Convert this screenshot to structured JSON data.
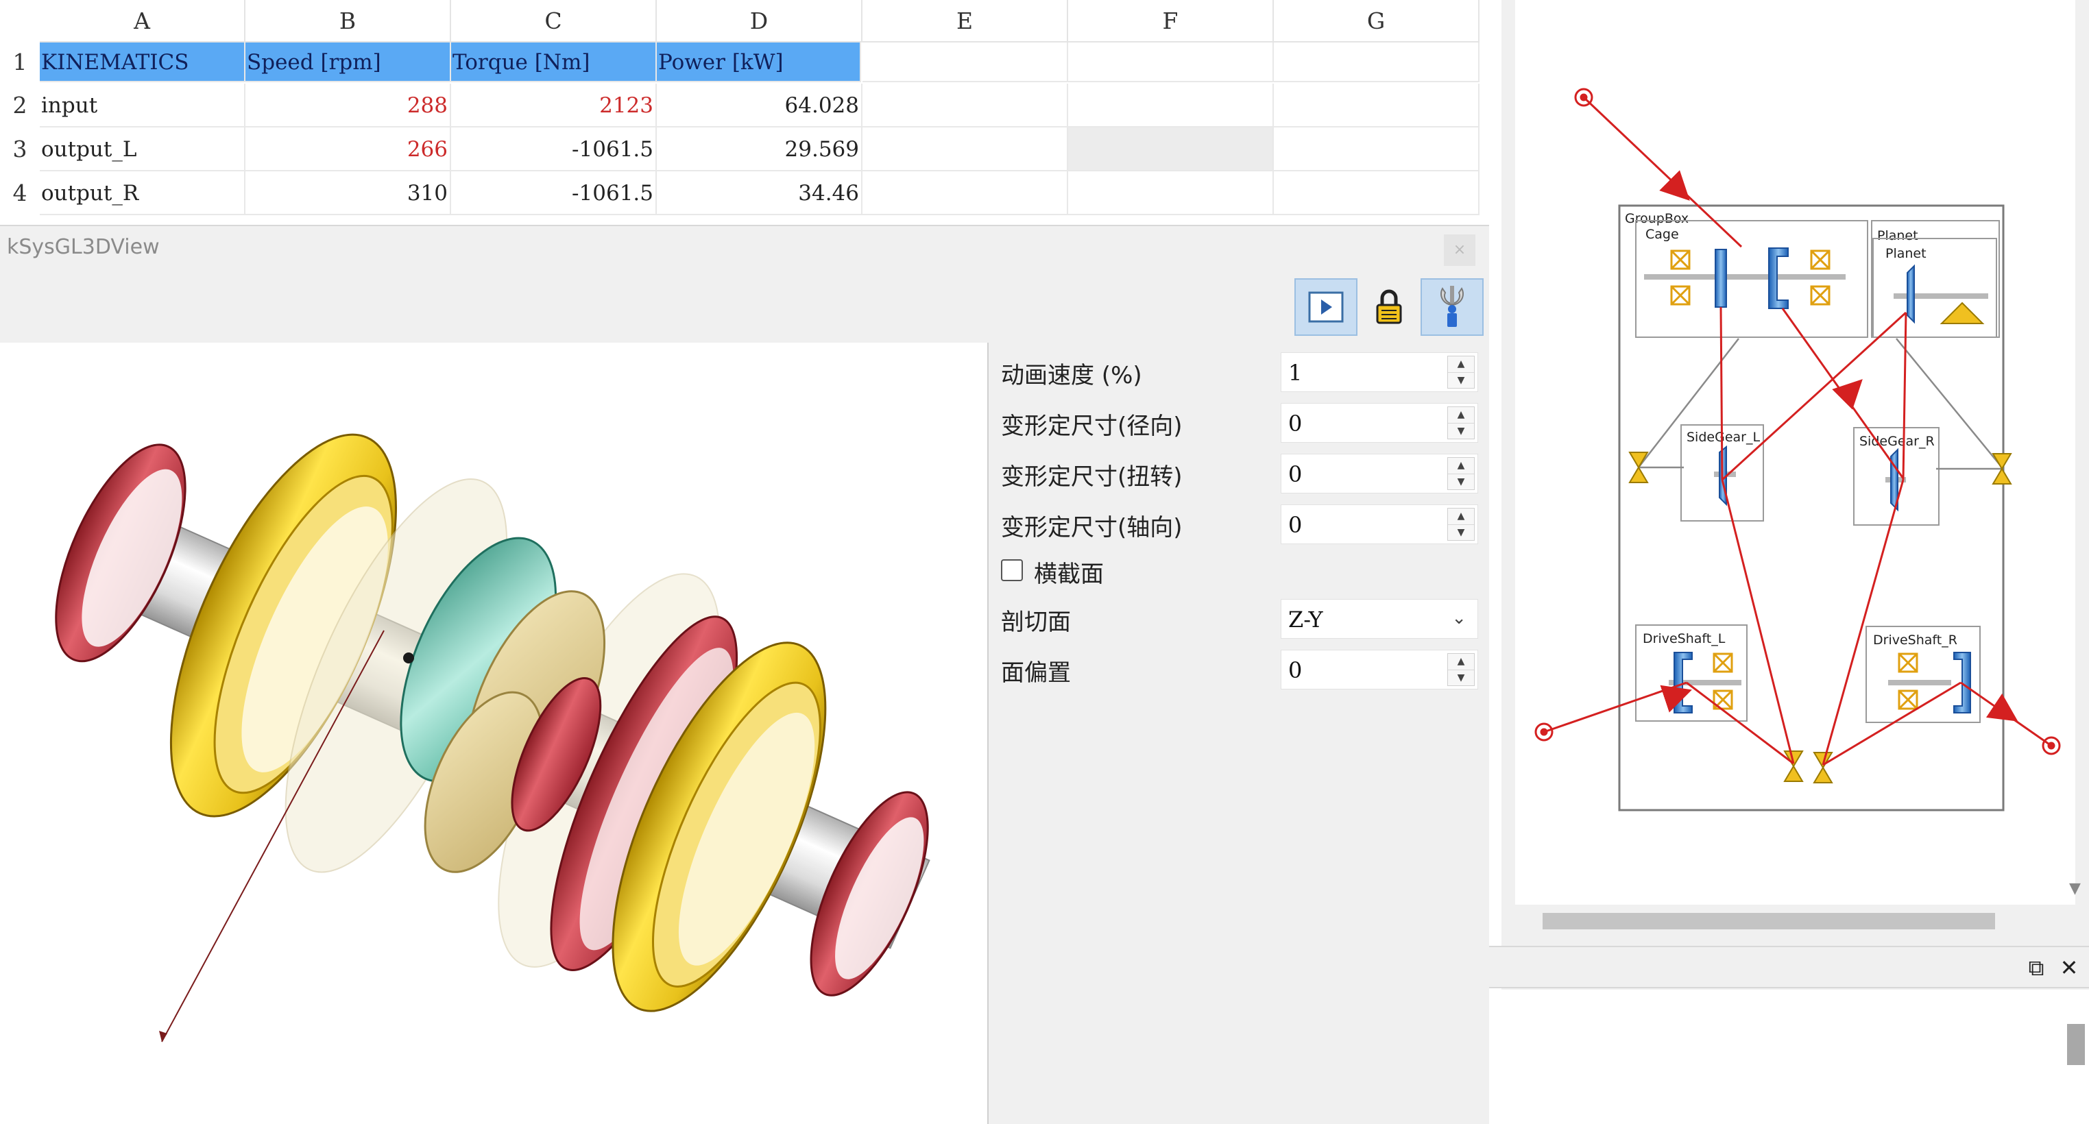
{
  "sheet": {
    "columns": [
      "A",
      "B",
      "C",
      "D",
      "E",
      "F",
      "G"
    ],
    "row_numbers": [
      "1",
      "2",
      "3",
      "4"
    ],
    "header_row": [
      "KINEMATICS",
      "Speed [rpm]",
      "Torque [Nm]",
      "Power [kW]"
    ],
    "rows": [
      {
        "name": "input",
        "speed": "288",
        "torque": "2123",
        "power": "64.028"
      },
      {
        "name": "output_L",
        "speed": "266",
        "torque": "-1061.5",
        "power": "29.569"
      },
      {
        "name": "output_R",
        "speed": "310",
        "torque": "-1061.5",
        "power": "34.46"
      }
    ],
    "colors": {
      "header_fill": "#5aa9f4",
      "highlight_text": "#cc2a2a"
    }
  },
  "view3d": {
    "title": "kSysGL3DView",
    "close_label": "×",
    "toolbar": [
      "play-icon",
      "lock-icon",
      "wrench-icon"
    ],
    "properties": {
      "animation_speed": {
        "label": "动画速度 (%)",
        "value": "1"
      },
      "deform_radial": {
        "label": "变形定尺寸(径向)",
        "value": "0"
      },
      "deform_torsion": {
        "label": "变形定尺寸(扭转)",
        "value": "0"
      },
      "deform_axial": {
        "label": "变形定尺寸(轴向)",
        "value": "0"
      },
      "cross_section": {
        "label": "横截面",
        "checked": false
      },
      "section_plane": {
        "label": "剖切面",
        "value": "Z-Y"
      },
      "face_offset": {
        "label": "面偏置",
        "value": "0"
      }
    },
    "colors": {
      "bearing": "#e8c21c",
      "ring": "#c2303a",
      "gear": "#6cc7ad"
    }
  },
  "schematic": {
    "labels": {
      "groupbox": "GroupBox",
      "cage": "Cage",
      "planet_outer": "Planet",
      "planet_inner": "Planet",
      "sidegear_l": "SideGear_L",
      "sidegear_r": "SideGear_R",
      "driveshaft_l": "DriveShaft_L",
      "driveshaft_r": "DriveShaft_R"
    },
    "colors": {
      "flow": "#d42020",
      "gear": "#2a70c4",
      "bearing": "#f0c020"
    }
  },
  "dock": {
    "restore_label": "⧉",
    "close_label": "✕"
  }
}
